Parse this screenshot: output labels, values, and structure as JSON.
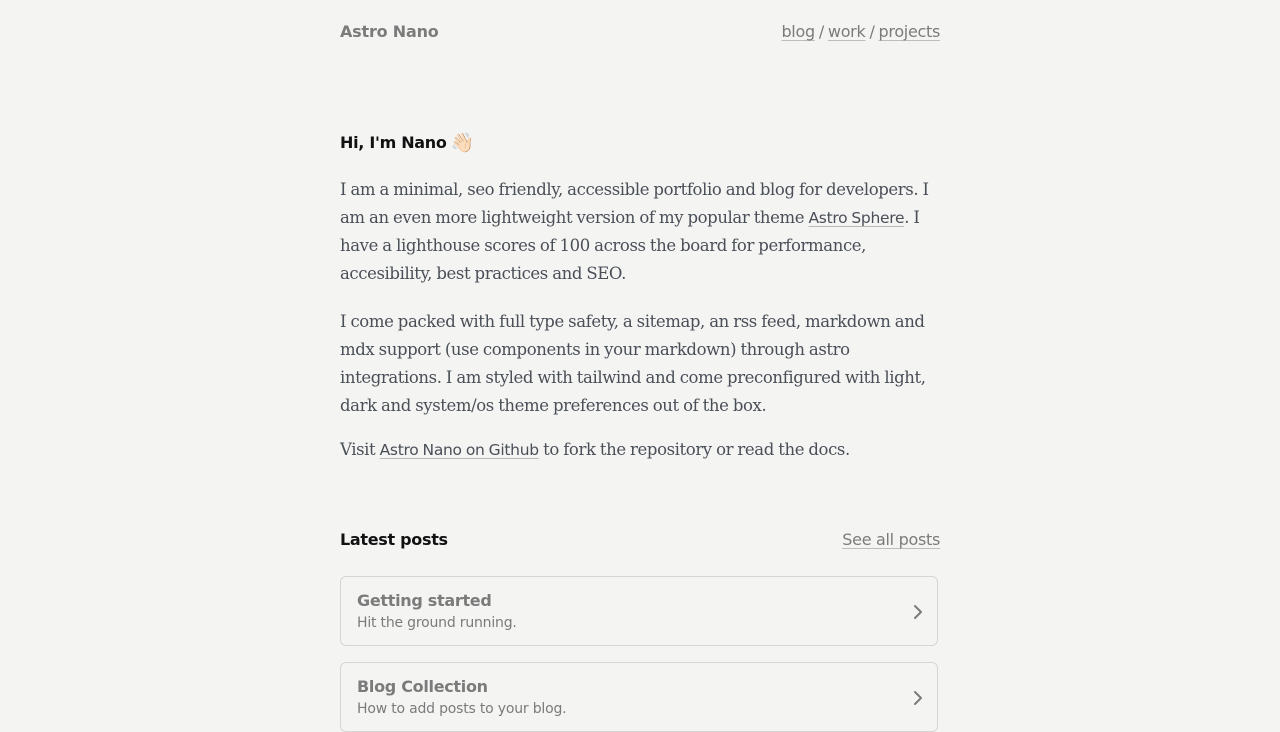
{
  "header": {
    "brand": "Astro Nano",
    "nav": [
      {
        "label": "blog"
      },
      {
        "label": "work"
      },
      {
        "label": "projects"
      }
    ],
    "separator": "/"
  },
  "intro": {
    "heading": "Hi, I'm Nano",
    "wave_emoji": "👋🏻",
    "p1_before": "I am a minimal, seo friendly, accessible portfolio and blog for developers. I am an even more lightweight version of my popular theme ",
    "p1_link": "Astro Sphere",
    "p1_after": ". I have a lighthouse scores of 100 across the board for performance, accesibility, best practices and SEO.",
    "p2": "I come packed with full type safety, a sitemap, an rss feed, markdown and mdx support (use components in your markdown) through astro integrations. I am styled with tailwind and come preconfigured with light, dark and system/os theme preferences out of the box.",
    "p3_before": "Visit ",
    "p3_link": "Astro Nano on Github",
    "p3_after": " to fork the repository or read the docs."
  },
  "latest_posts": {
    "title": "Latest posts",
    "see_all": "See all posts",
    "posts": [
      {
        "title": "Getting started",
        "description": "Hit the ground running."
      },
      {
        "title": "Blog Collection",
        "description": "How to add posts to your blog."
      }
    ]
  },
  "icons": {
    "post_arrow": "chevron-right-icon",
    "wave": "waving-hand-icon"
  },
  "colors": {
    "background": "#f4f4f3",
    "muted_text": "#7b7b7b",
    "body_text": "#4a4f57",
    "heading_text": "#111111",
    "card_border": "#d6d6d4"
  }
}
